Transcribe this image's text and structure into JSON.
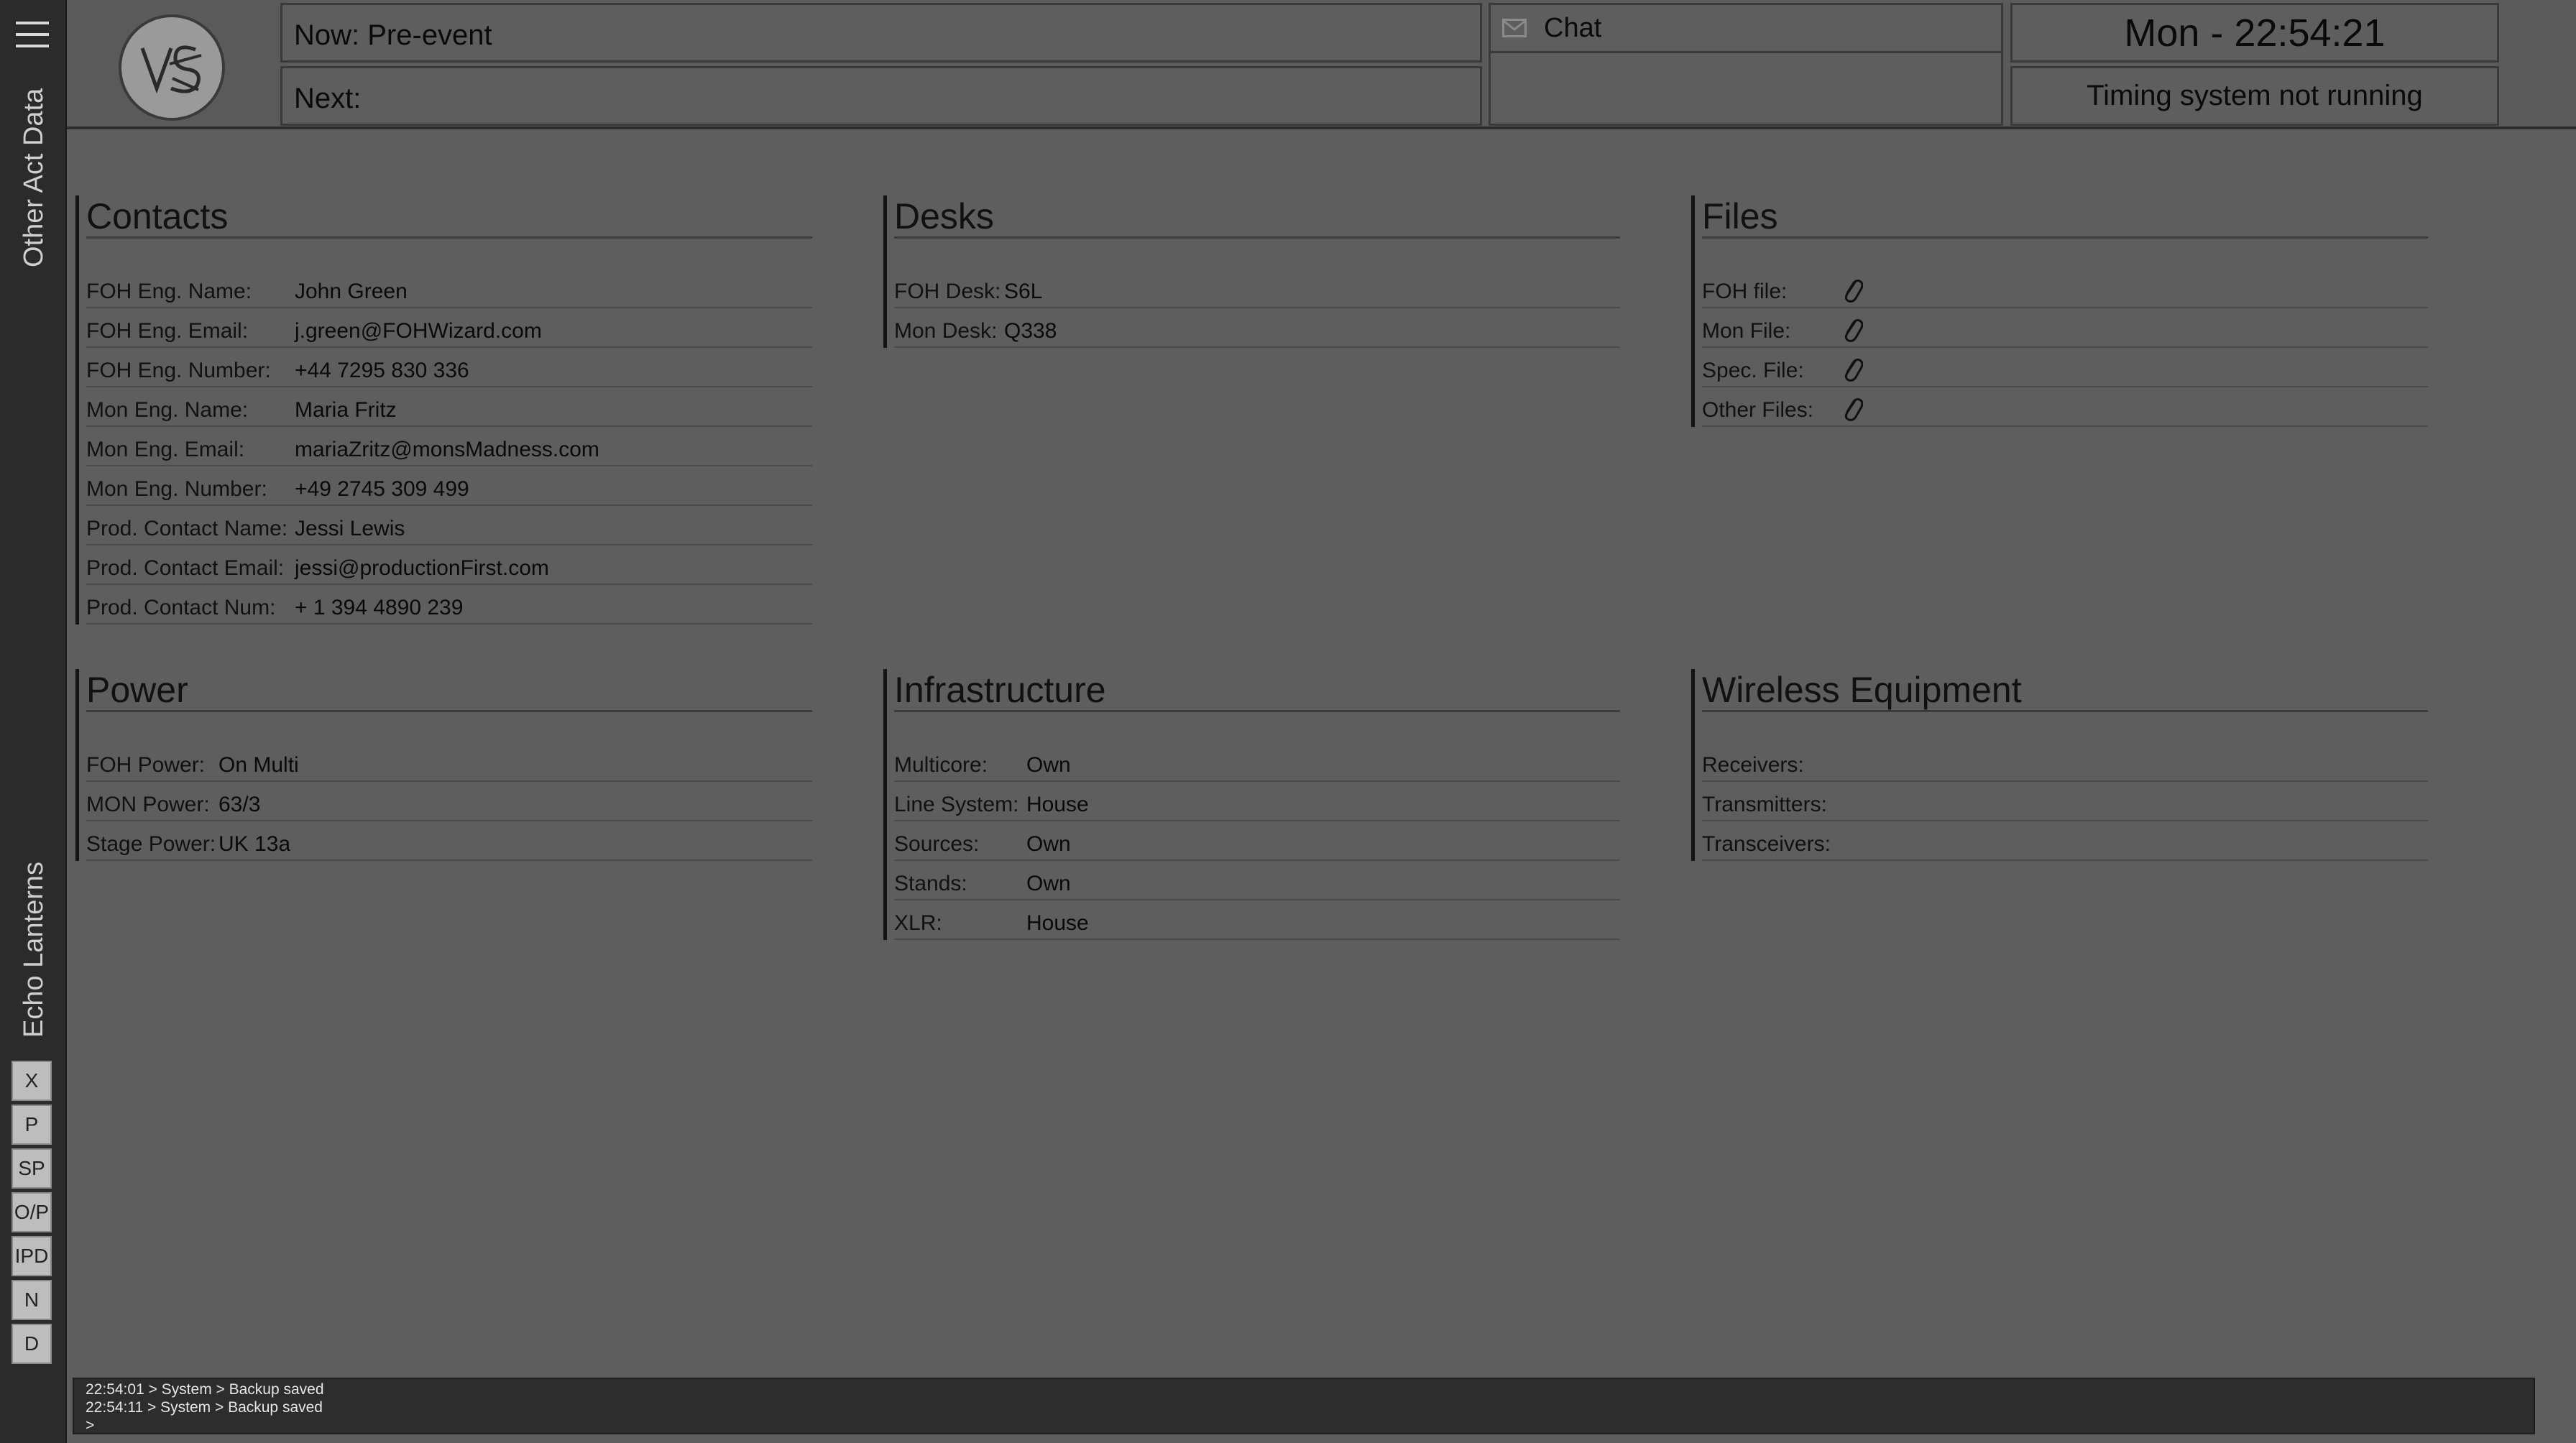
{
  "sidebar": {
    "menu_icon": "hamburger-icon",
    "label_top": "Other Act Data",
    "label_bottom": "Echo Lanterns",
    "buttons": [
      "X",
      "P",
      "SP",
      "O/P",
      "IPD",
      "N",
      "D"
    ]
  },
  "header": {
    "logo_icon": "vs-logo",
    "now": "Now: Pre-event",
    "next": "Next:",
    "chat_label": "Chat",
    "chat_icon": "envelope-icon",
    "clock": "Mon - 22:54:21",
    "timing_status": "Timing system not running"
  },
  "contacts": {
    "title": "Contacts",
    "rows": [
      {
        "label": "FOH Eng. Name:",
        "value": "John Green"
      },
      {
        "label": "FOH Eng. Email:",
        "value": "j.green@FOHWizard.com"
      },
      {
        "label": "FOH Eng. Number:",
        "value": "+44 7295 830 336"
      },
      {
        "label": "Mon Eng. Name:",
        "value": "Maria Fritz"
      },
      {
        "label": "Mon Eng. Email:",
        "value": "mariaZritz@monsMadness.com"
      },
      {
        "label": "Mon Eng. Number:",
        "value": "+49 2745 309 499"
      },
      {
        "label": "Prod. Contact Name:",
        "value": "Jessi Lewis"
      },
      {
        "label": "Prod. Contact Email:",
        "value": "jessi@productionFirst.com"
      },
      {
        "label": "Prod. Contact Num:",
        "value": "+ 1 394 4890 239"
      }
    ]
  },
  "desks": {
    "title": "Desks",
    "rows": [
      {
        "label": "FOH Desk:",
        "value": "S6L"
      },
      {
        "label": "Mon Desk:",
        "value": "Q338"
      }
    ]
  },
  "files": {
    "title": "Files",
    "rows": [
      {
        "label": "FOH file:",
        "icon": "paperclip-icon"
      },
      {
        "label": "Mon File:",
        "icon": "paperclip-icon"
      },
      {
        "label": "Spec. File:",
        "icon": "paperclip-icon"
      },
      {
        "label": "Other Files:",
        "icon": "paperclip-icon"
      }
    ]
  },
  "power": {
    "title": "Power",
    "rows": [
      {
        "label": "FOH Power:",
        "value": "On Multi"
      },
      {
        "label": "MON Power:",
        "value": "63/3"
      },
      {
        "label": "Stage Power:",
        "value": "UK 13a"
      }
    ]
  },
  "infrastructure": {
    "title": "Infrastructure",
    "rows": [
      {
        "label": "Multicore:",
        "value": "Own"
      },
      {
        "label": "Line System:",
        "value": "House"
      },
      {
        "label": "Sources:",
        "value": "Own"
      },
      {
        "label": "Stands:",
        "value": "Own"
      },
      {
        "label": "XLR:",
        "value": "House"
      }
    ]
  },
  "wireless": {
    "title": "Wireless Equipment",
    "rows": [
      {
        "label": "Receivers:",
        "value": ""
      },
      {
        "label": "Transmitters:",
        "value": ""
      },
      {
        "label": "Transceivers:",
        "value": ""
      }
    ]
  },
  "console": {
    "lines": [
      "22:54:01 > System > Backup saved",
      "22:54:11 > System > Backup saved",
      ">"
    ]
  }
}
